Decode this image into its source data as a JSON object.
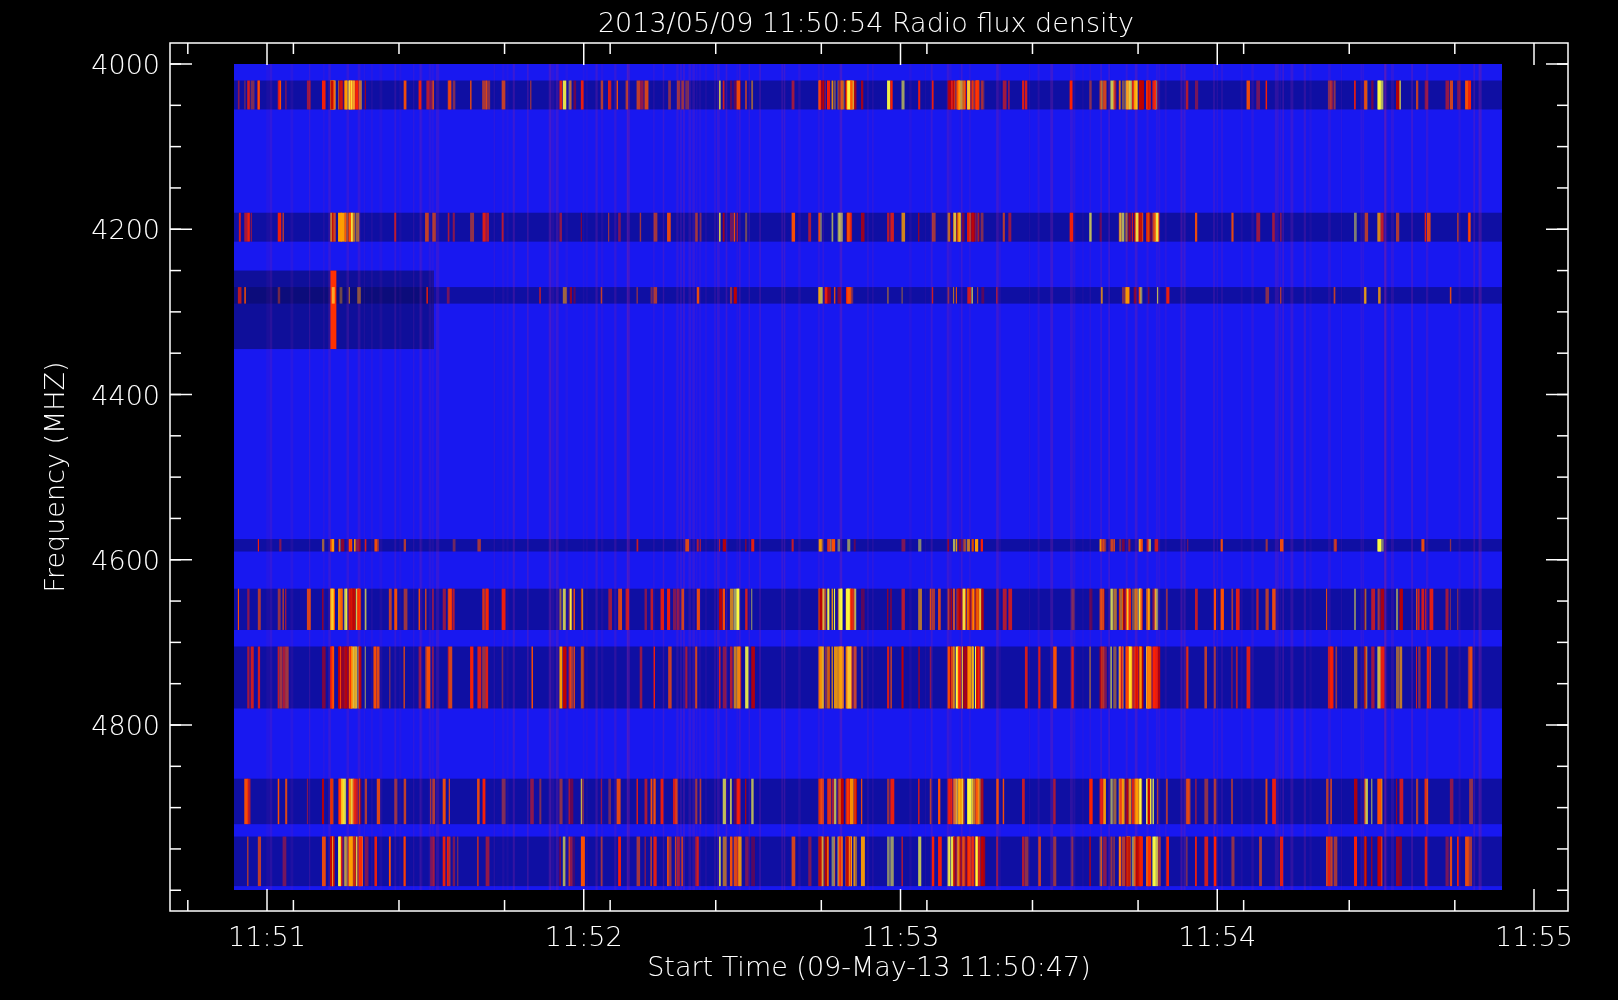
{
  "plot": {
    "title": "2013/05/09 11:50:54 Radio flux density",
    "ylabel": "Frequency (MHZ)",
    "xlabel": "Start Time (09-May-13 11:50:47)",
    "ytick_labels": [
      "4000",
      "4200",
      "4400",
      "4600",
      "4800"
    ],
    "xtick_labels": [
      "11:51",
      "11:52",
      "11:53",
      "11:54",
      "11:55"
    ]
  }
}
